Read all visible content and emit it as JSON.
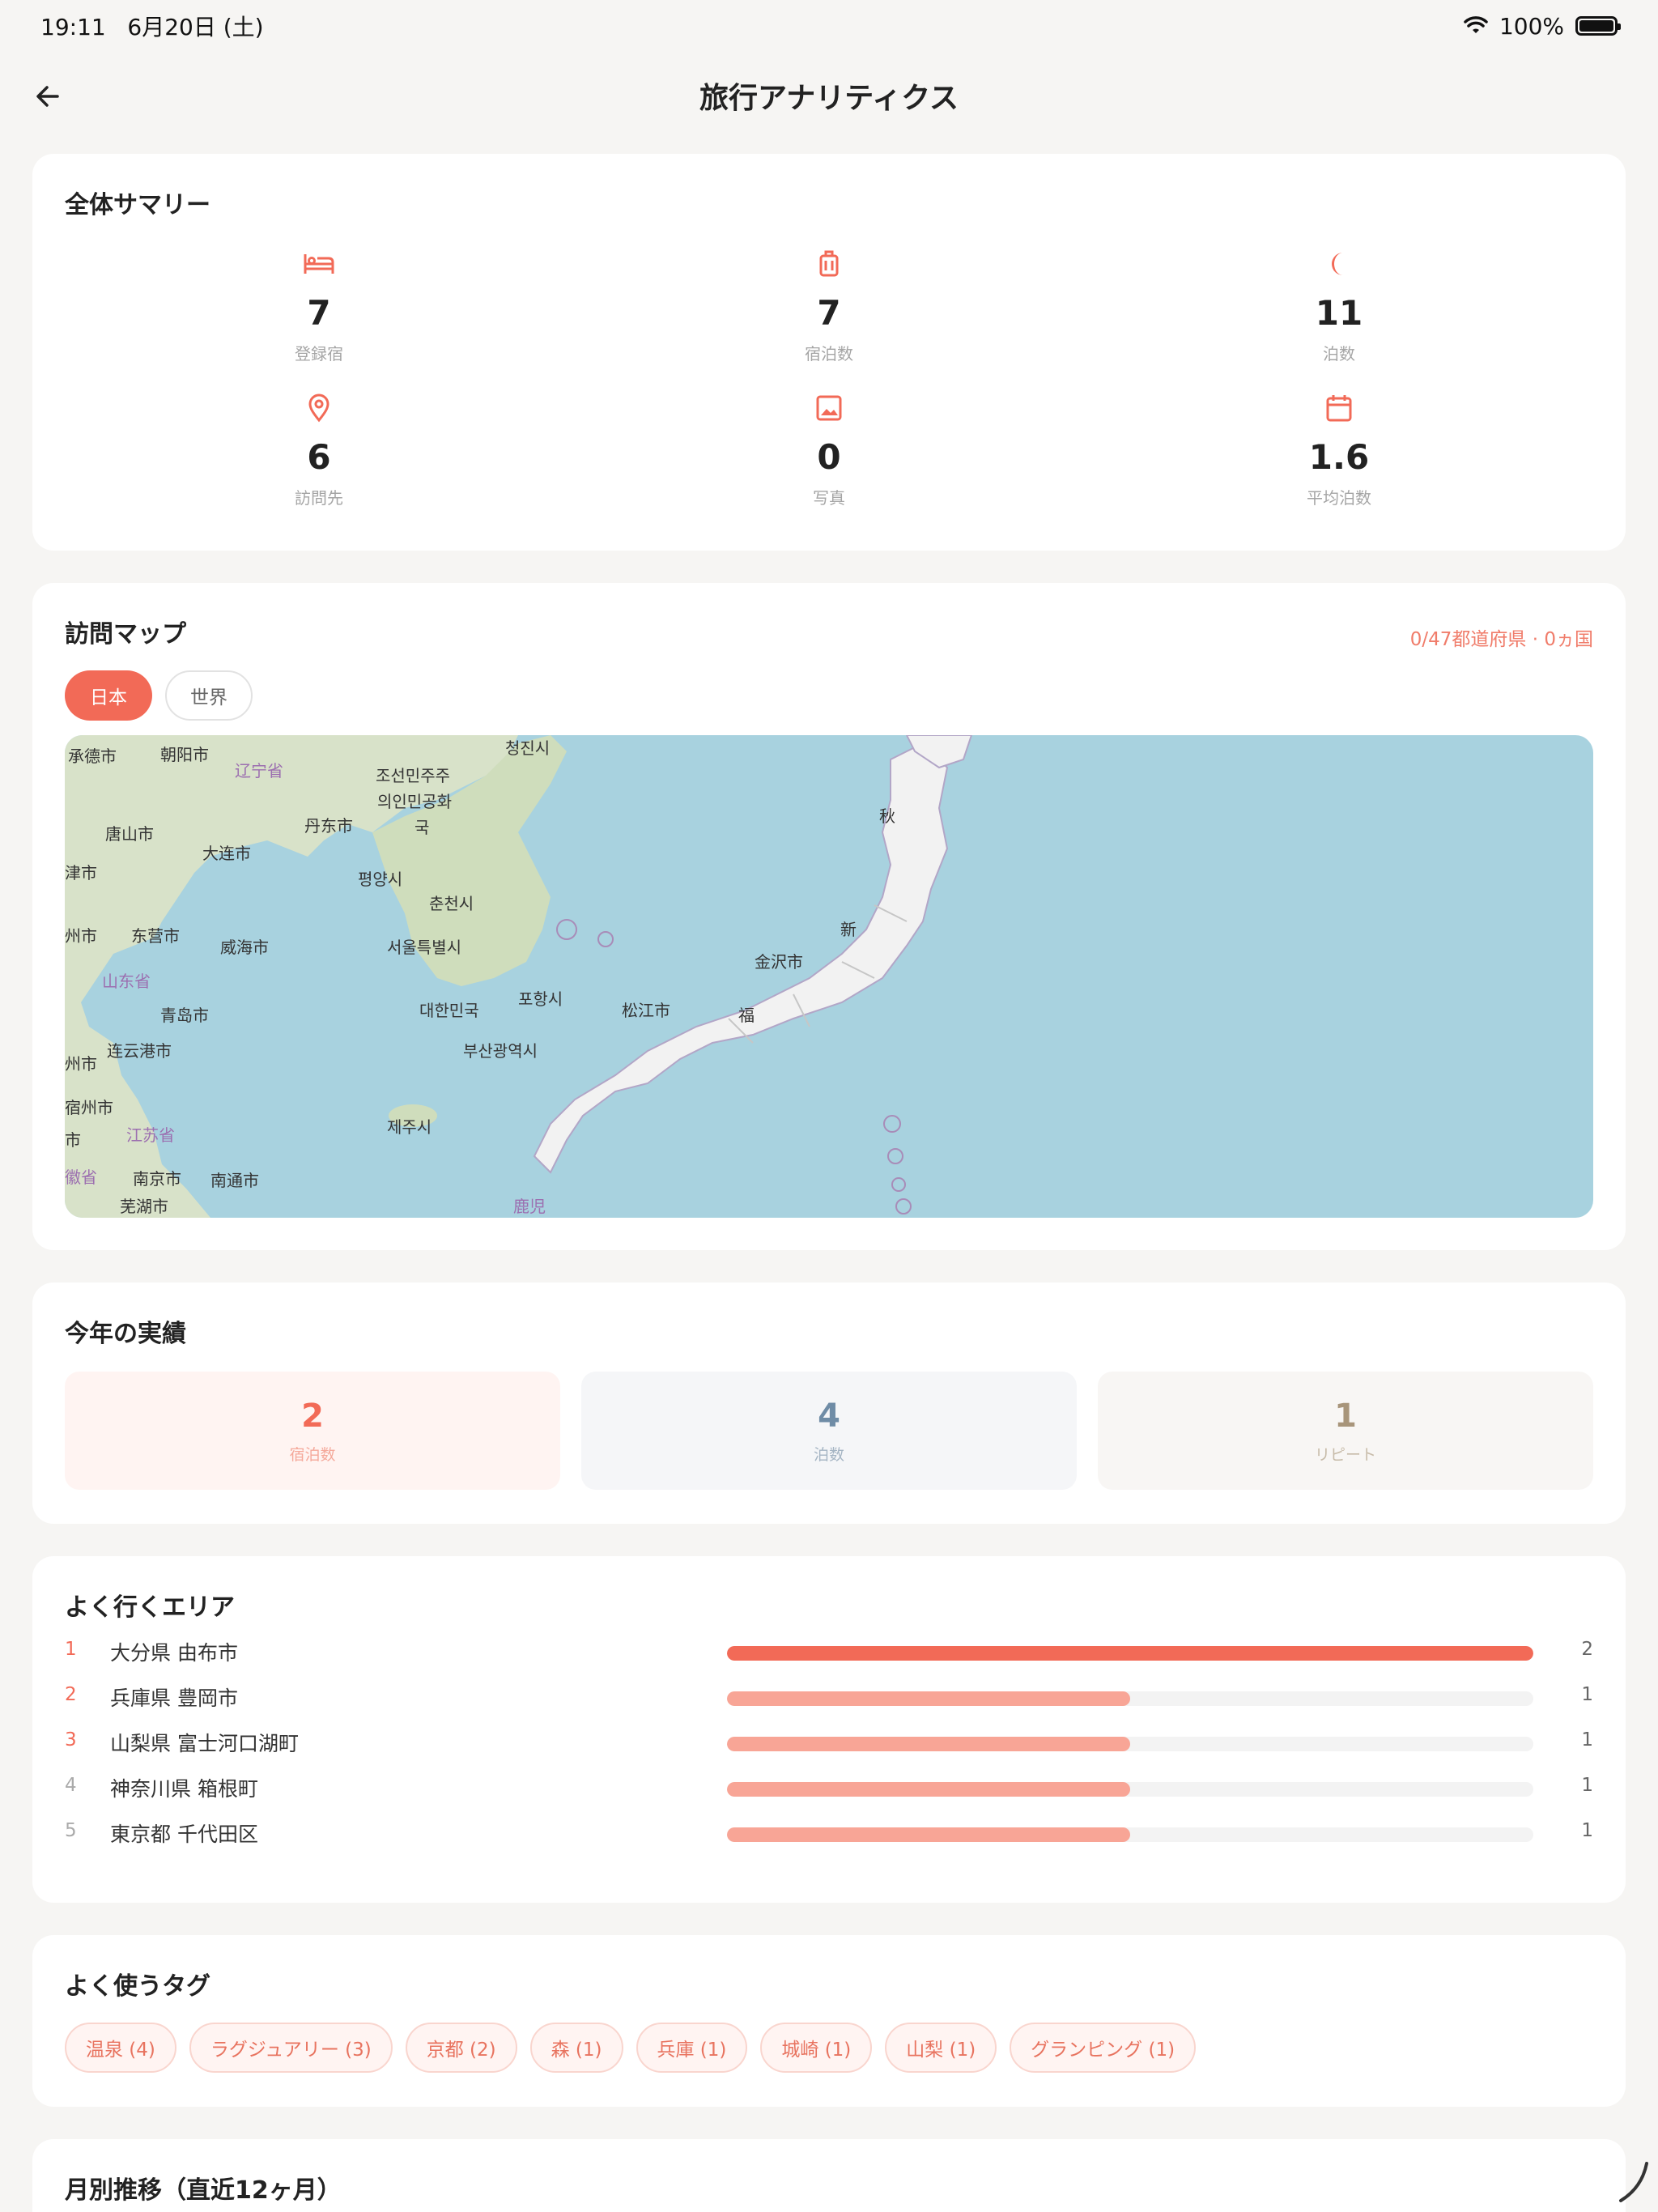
{
  "status": {
    "time": "19:11",
    "date": "6月20日 (土)",
    "battery": "100%"
  },
  "header": {
    "title": "旅行アナリティクス"
  },
  "summary": {
    "title": "全体サマリー",
    "items": [
      {
        "icon": "bed-icon",
        "value": "7",
        "label": "登録宿"
      },
      {
        "icon": "suitcase-icon",
        "value": "7",
        "label": "宿泊数"
      },
      {
        "icon": "moon-icon",
        "value": "11",
        "label": "泊数"
      },
      {
        "icon": "location-pin-icon",
        "value": "6",
        "label": "訪問先"
      },
      {
        "icon": "photo-icon",
        "value": "0",
        "label": "写真"
      },
      {
        "icon": "calendar-icon",
        "value": "1.6",
        "label": "平均泊数"
      }
    ]
  },
  "map": {
    "title": "訪問マップ",
    "count": "0/47都道府県 · 0ヵ国",
    "tabs": [
      "日本",
      "世界"
    ],
    "labels": [
      "承德市",
      "朝阳市",
      "辽宁省",
      "조선민주주",
      "의인민공화",
      "국",
      "丹东市",
      "唐山市",
      "大连市",
      "津市",
      "평양시",
      "춘천시",
      "州市",
      "东营市",
      "威海市",
      "서울특별시",
      "山东省",
      "青岛市",
      "대한민국",
      "포항시",
      "부산광역시",
      "连云港市",
      "州市",
      "宿州市",
      "江苏省",
      "제주시",
      "南京市",
      "南通市",
      "芜湖市",
      "徽省",
      "市",
      "松江市",
      "金沢市",
      "秋",
      "新",
      "福",
      "청진시",
      "鹿児"
    ]
  },
  "year": {
    "title": "今年の実績",
    "items": [
      {
        "value": "2",
        "label": "宿泊数"
      },
      {
        "value": "4",
        "label": "泊数"
      },
      {
        "value": "1",
        "label": "リピート"
      }
    ]
  },
  "areas": {
    "title": "よく行くエリア",
    "items": [
      {
        "rank": "1",
        "name": "大分県 由布市",
        "count": "2",
        "ratio": 1.0
      },
      {
        "rank": "2",
        "name": "兵庫県 豊岡市",
        "count": "1",
        "ratio": 0.5
      },
      {
        "rank": "3",
        "name": "山梨県 富士河口湖町",
        "count": "1",
        "ratio": 0.5
      },
      {
        "rank": "4",
        "name": "神奈川県 箱根町",
        "count": "1",
        "ratio": 0.5
      },
      {
        "rank": "5",
        "name": "東京都 千代田区",
        "count": "1",
        "ratio": 0.5
      }
    ]
  },
  "tags": {
    "title": "よく使うタグ",
    "items": [
      "温泉 (4)",
      "ラグジュアリー (3)",
      "京都 (2)",
      "森 (1)",
      "兵庫 (1)",
      "城崎 (1)",
      "山梨 (1)",
      "グランピング (1)"
    ]
  },
  "monthly": {
    "title": "月別推移（直近12ヶ月）"
  },
  "colors": {
    "accent": "#F26A57",
    "accent_light": "#F8A596",
    "blue": "#6F8CA6",
    "tan": "#A8957A"
  }
}
